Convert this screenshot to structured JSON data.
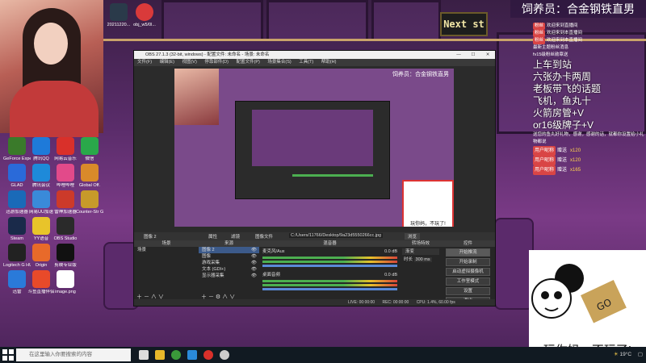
{
  "background": {
    "next_sign": "Next st"
  },
  "overlay": {
    "title": "饲养员：合金钢铁直男",
    "chat": [
      "欢迎来到直播间",
      "欢迎来到本直播间",
      "欢迎来到本直播间",
      "最新主题粉丝消息",
      "fv15级粉丝勋章送"
    ],
    "big_messages": [
      "上车到站",
      "六张办卡两周",
      "老板带飞的话题",
      "飞机，鱼丸十",
      "火箭房管+V",
      "or16级牌子+V"
    ],
    "notice": "送您的鱼丸好礼物，感谢，感谢的话，就都你设置给小礼物都说",
    "gifts": [
      {
        "user": "用户昵称",
        "gift": "赠送",
        "amount": "x120"
      },
      {
        "user": "用户昵称",
        "gift": "赠送",
        "amount": "x120"
      },
      {
        "user": "用户昵称",
        "gift": "赠送",
        "amount": "x165"
      }
    ],
    "sticker_caption": "玩你妈，不玩了!"
  },
  "desktop_icons": [
    {
      "label": "GeForce Experience",
      "color": "#3a7a2a"
    },
    {
      "label": "腾讯QQ",
      "color": "#1e7ad9"
    },
    {
      "label": "网易云音乐",
      "color": "#d9302a"
    },
    {
      "label": "微信",
      "color": "#2aa84a"
    },
    {
      "label": "GLAD",
      "color": "#2a6ad9"
    },
    {
      "label": "腾讯会议",
      "color": "#1e8ad9"
    },
    {
      "label": "哔哩哔哩",
      "color": "#e24a8a"
    },
    {
      "label": "Global Off.",
      "color": "#d98a2a"
    },
    {
      "label": "迅游加速器",
      "color": "#1a6ab8"
    },
    {
      "label": "网易UU加速",
      "color": "#3a8ad9"
    },
    {
      "label": "雷神加速器",
      "color": "#cc3a2a"
    },
    {
      "label": "Counter-Str Global Of",
      "color": "#c79a2a"
    },
    {
      "label": "Steam",
      "color": "#1a2a4a"
    },
    {
      "label": "YY语音",
      "color": "#e8c42a"
    },
    {
      "label": "OBS Studio",
      "color": "#2a2a2a"
    },
    {
      "label": "Logitech G HUB",
      "color": "#222"
    },
    {
      "label": "Origin",
      "color": "#e86a2a"
    },
    {
      "label": "剪映专业版",
      "color": "#111"
    },
    {
      "label": "迅雷",
      "color": "#2a7ad9"
    },
    {
      "label": "斗鱼直播伴侣",
      "color": "#e84a2a"
    },
    {
      "label": "image.png",
      "color": "#fff"
    }
  ],
  "top_icons": [
    {
      "label": "20211220...",
      "color": "#2a3a4a"
    },
    {
      "label": "obj_w5/0l...",
      "color": "#d93a3a"
    }
  ],
  "obs": {
    "title": "OBS 27.1.3 (32-bit, windows) - 配置文件: 未命名 - 场景: 未命名",
    "menu": [
      "文件(F)",
      "编辑(E)",
      "视图(V)",
      "停靠部件(D)",
      "配置文件(P)",
      "场景集合(S)",
      "工具(T)",
      "帮助(H)"
    ],
    "preview_title": "饲养员：合金钢铁直男",
    "preview_sticker_caption": "玩你妈，不玩了!",
    "dock_source_label": "图像 2",
    "dock_buttons": [
      "属性",
      "滤镜",
      "图像文件"
    ],
    "dock_path": "C:/Users/11766/Desktop/9a23d5550266cc.jpg",
    "browse_label": "浏览",
    "panels": {
      "scenes": {
        "header": "场景",
        "items": [
          "场景"
        ]
      },
      "sources": {
        "header": "来源",
        "items": [
          "图像 2",
          "图像",
          "游戏采集",
          "文本 (GDI+)",
          "显示器采集"
        ]
      },
      "mixer": {
        "header": "混音器",
        "tracks": [
          {
            "name": "麦克风/Aux",
            "db": "0.0 dB"
          },
          {
            "name": "桌面音频",
            "db": "0.0 dB"
          }
        ]
      },
      "transitions": {
        "header": "转场特效",
        "type": "渐变",
        "duration_label": "时长",
        "duration": "300 ms"
      },
      "controls": {
        "header": "控件",
        "buttons": [
          "开始推流",
          "开始录制",
          "启动虚拟摄像机",
          "工作室模式",
          "设置",
          "退出"
        ]
      }
    },
    "status": {
      "live": "LIVE: 00:00:00",
      "rec": "REC: 00:00:00",
      "cpu": "CPU: 1.4%, 60.00 fps"
    }
  },
  "taskbar": {
    "search_placeholder": "在这里输入你要搜索的内容",
    "weather": "19°C",
    "time": "",
    "apps": [
      {
        "name": "task-view",
        "color": "#ddd"
      },
      {
        "name": "file-explorer",
        "color": "#e8b82a"
      },
      {
        "name": "chrome",
        "color": "#3a9a3a"
      },
      {
        "name": "edge",
        "color": "#2a8ad9"
      },
      {
        "name": "netease-music",
        "color": "#d9302a"
      },
      {
        "name": "obs",
        "color": "#ccc"
      }
    ]
  }
}
